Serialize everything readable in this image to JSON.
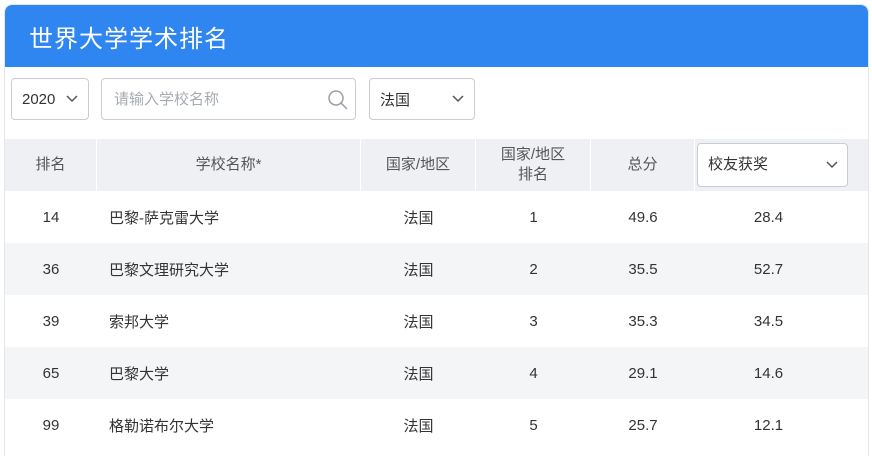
{
  "header": {
    "title": "世界大学学术排名"
  },
  "filters": {
    "year": "2020",
    "search_placeholder": "请输入学校名称",
    "country": "法国"
  },
  "table": {
    "headers": {
      "rank": "排名",
      "school": "学校名称*",
      "country": "国家/地区",
      "country_rank_line1": "国家/地区",
      "country_rank_line2": "排名",
      "total": "总分",
      "indicator_select": "校友获奖"
    },
    "rows": [
      {
        "rank": "14",
        "school": "巴黎-萨克雷大学",
        "country": "法国",
        "country_rank": "1",
        "total": "49.6",
        "indicator": "28.4"
      },
      {
        "rank": "36",
        "school": "巴黎文理研究大学",
        "country": "法国",
        "country_rank": "2",
        "total": "35.5",
        "indicator": "52.7"
      },
      {
        "rank": "39",
        "school": "索邦大学",
        "country": "法国",
        "country_rank": "3",
        "total": "35.3",
        "indicator": "34.5"
      },
      {
        "rank": "65",
        "school": "巴黎大学",
        "country": "法国",
        "country_rank": "4",
        "total": "29.1",
        "indicator": "14.6"
      },
      {
        "rank": "99",
        "school": "格勒诺布尔大学",
        "country": "法国",
        "country_rank": "5",
        "total": "25.7",
        "indicator": "12.1"
      }
    ]
  },
  "icons": {
    "search": "search-icon",
    "dropdown": "chevron-down-icon"
  },
  "colors": {
    "header_bg": "#2f86f1",
    "header_text": "#ffffff",
    "table_header_bg": "#eef0f3",
    "row_alt_bg": "#f4f5f7"
  }
}
